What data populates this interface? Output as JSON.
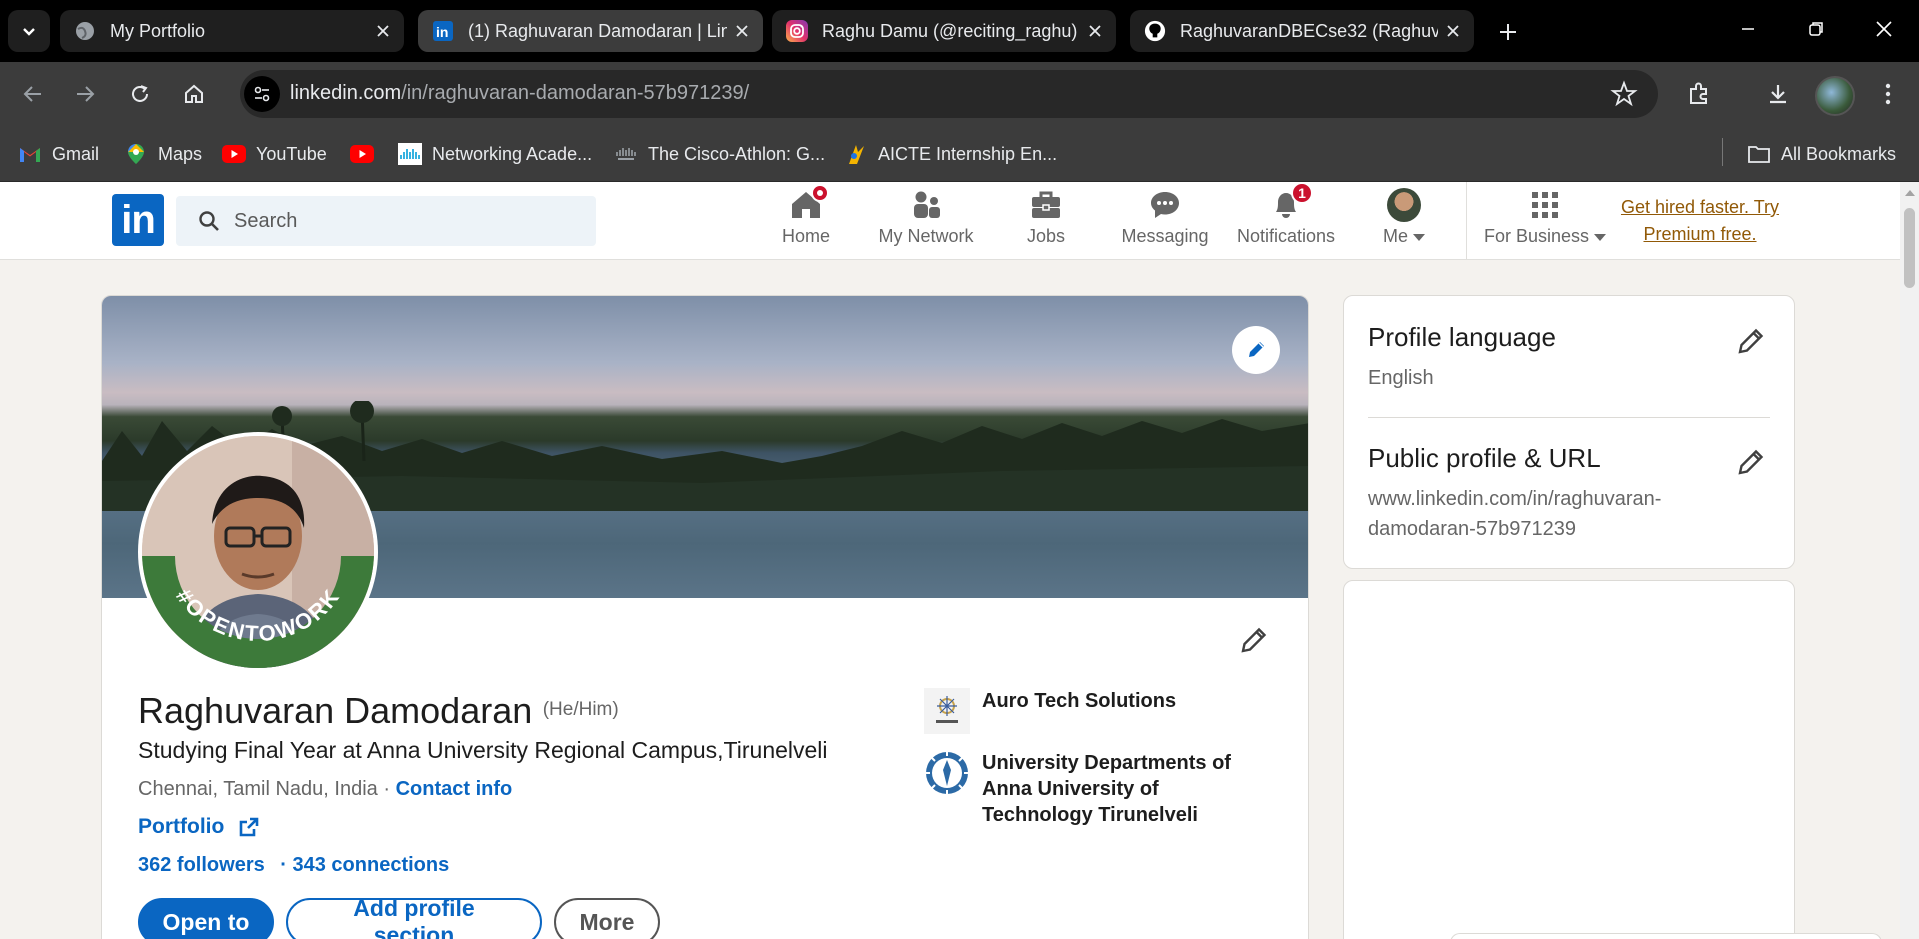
{
  "browser": {
    "tabs": [
      {
        "title": "My Portfolio",
        "icon": "globe-icon"
      },
      {
        "title": "(1) Raghuvaran Damodaran | LinkedIn",
        "icon": "linkedin-icon"
      },
      {
        "title": "Raghu Damu (@reciting_raghu)",
        "icon": "instagram-icon"
      },
      {
        "title": "RaghuvaranDBECse32 (Raghuvaran)",
        "icon": "github-icon"
      }
    ],
    "url_domain": "linkedin.com",
    "url_path": "/in/raghuvaran-damodaran-57b971239/",
    "bookmarks": [
      {
        "label": "Gmail",
        "icon": "gmail-icon"
      },
      {
        "label": "Maps",
        "icon": "maps-icon"
      },
      {
        "label": "YouTube",
        "icon": "youtube-icon"
      },
      {
        "label": "",
        "icon": "youtube-icon"
      },
      {
        "label": "Networking Acade...",
        "icon": "cisco-icon"
      },
      {
        "label": "The Cisco-Athlon: G...",
        "icon": "cisco-icon"
      },
      {
        "label": "AICTE Internship En...",
        "icon": "aicte-icon"
      }
    ],
    "all_bookmarks": "All Bookmarks"
  },
  "linkedin": {
    "search_placeholder": "Search",
    "nav": {
      "home": "Home",
      "network": "My Network",
      "jobs": "Jobs",
      "messaging": "Messaging",
      "notifications": "Notifications",
      "notifications_count": "1",
      "me": "Me",
      "business": "For Business"
    },
    "premium": "Get hired faster. Try Premium free.",
    "brand_color": "#0a66c2"
  },
  "profile": {
    "name": "Raghuvaran Damodaran",
    "pronouns": "(He/Him)",
    "headline": "Studying Final Year at Anna University Regional Campus,Tirunelveli",
    "location": "Chennai, Tamil Nadu, India",
    "location_sep": " · ",
    "contact_info": "Contact info",
    "portfolio": "Portfolio",
    "followers": "362 followers",
    "connections": "· 343 connections",
    "open_to_frame": "#OPENTOWORK",
    "buttons": {
      "open_to": "Open to",
      "add_section": "Add profile section",
      "more": "More"
    },
    "orgs": [
      {
        "name": "Auro Tech Solutions"
      },
      {
        "name": "University Departments of Anna University of Technology Tirunelveli"
      }
    ]
  },
  "sidebar": {
    "language_title": "Profile language",
    "language_value": "English",
    "public_title": "Public profile & URL",
    "public_value": "www.linkedin.com/in/raghuvaran-damodaran-57b971239"
  }
}
